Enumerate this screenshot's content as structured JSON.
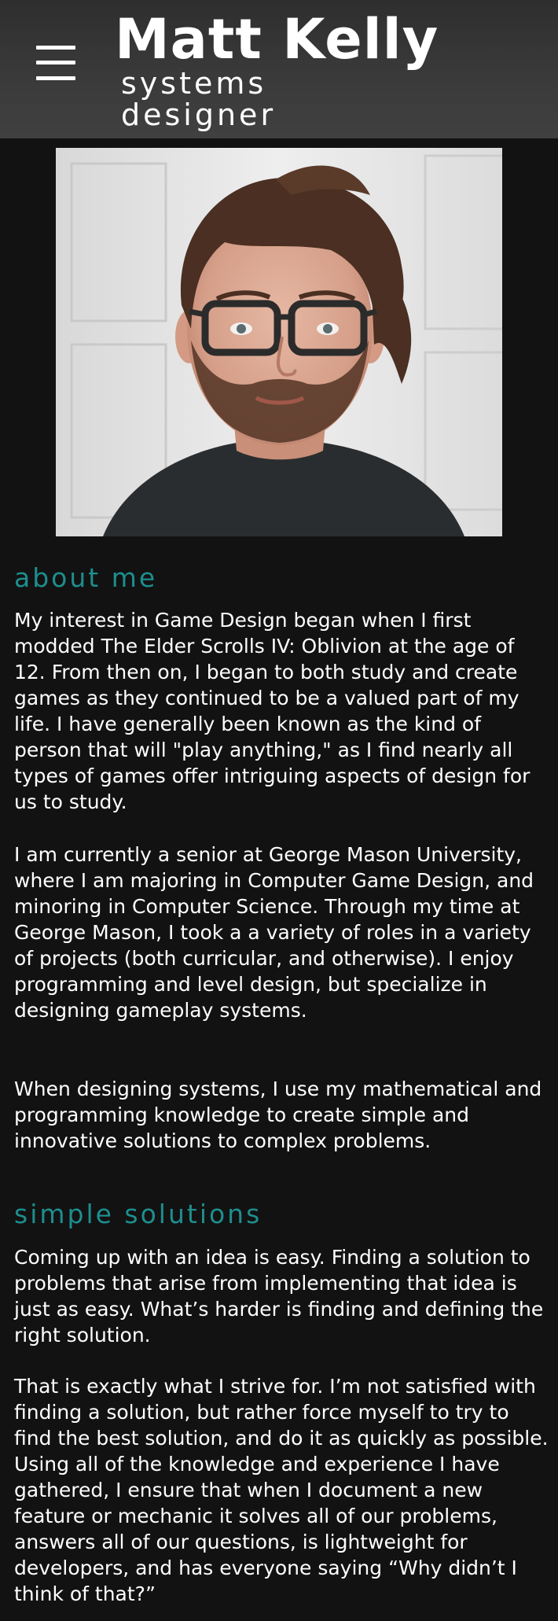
{
  "header": {
    "menu_icon": "hamburger-menu-icon",
    "name": "Matt Kelly",
    "role_line_1": "Systems",
    "role_line_2": "Designer"
  },
  "portrait": {
    "alt": "Portrait photo of Matt Kelly"
  },
  "about": {
    "heading": "About Me",
    "paragraphs": [
      "My interest in Game Design began when I first modded The Elder Scrolls IV: Oblivion at the age of 12. From then on, I began to both study and create games as they continued to be a valued part of my life. I have generally been known as the kind of person that will \"play anything,\" as I find nearly all types of games offer intriguing aspects of design for us to study.",
      "I am currently a senior at George Mason University, where I am majoring in Computer Game Design, and minoring in Computer Science. Through my time at George Mason, I took a a variety of roles in a variety of projects (both curricular, and otherwise). I enjoy programming and level design, but specialize in designing gameplay systems.",
      "When designing systems, I use my mathematical and programming knowledge to create simple and innovative solutions to complex problems."
    ]
  },
  "solutions": {
    "heading": "Simple Solutions",
    "paragraphs": [
      "Coming up with an idea is easy. Finding a solution to problems that arise from implementing that idea is just as easy. What’s harder is finding and defining the right solution.",
      "That is exactly what I strive for. I’m not satisfied with finding a solution, but rather force myself to try to find the best solution, and do it as quickly as possible. Using all of the knowledge and experience I have gathered, I ensure that when I document a new feature or mechanic it solves all of our problems, answers all of our questions, is lightweight for developers, and has everyone saying “Why didn’t I think of that?”"
    ]
  },
  "colors": {
    "background": "#121212",
    "header": "#3a3a3a",
    "accent": "#1e8e8e",
    "text": "#ffffff"
  }
}
